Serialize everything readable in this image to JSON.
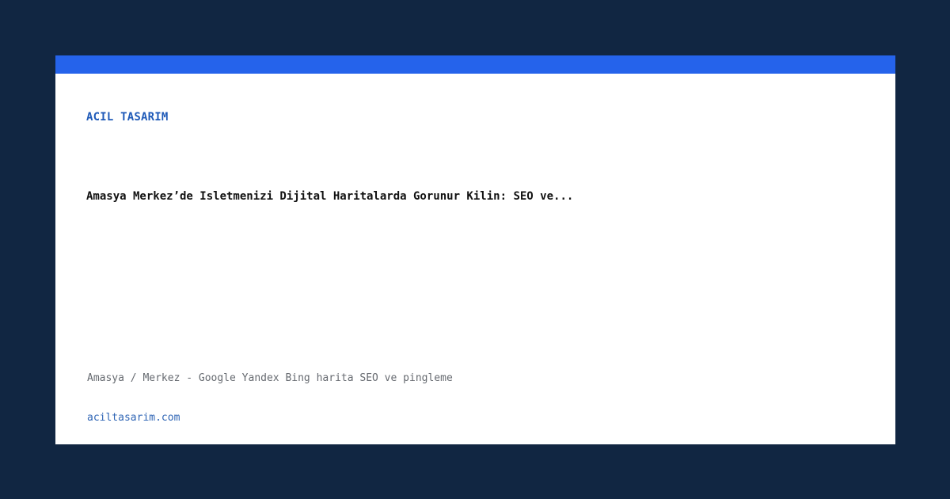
{
  "colors": {
    "background": "#112642",
    "card": "#ffffff",
    "accent_bar": "#2563eb",
    "brand": "#1f5ab8",
    "headline": "#111111",
    "location": "#666a70",
    "domain": "#2f65b5"
  },
  "card": {
    "brand": "ACIL TASARIM",
    "headline": "Amasya Merkez’de Isletmenizi Dijital Haritalarda Gorunur Kilin: SEO ve...",
    "location": "Amasya / Merkez - Google Yandex Bing harita SEO ve pingleme",
    "domain": "aciltasarim.com"
  }
}
